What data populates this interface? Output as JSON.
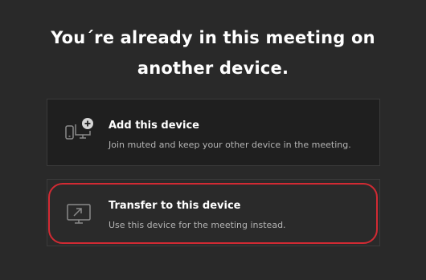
{
  "dialog": {
    "title_line1": "You´re already in this meeting on",
    "title_line2": "another device."
  },
  "options": [
    {
      "icon": "add-device-icon",
      "label": "Add this device",
      "description": "Join muted and keep your other device in the meeting."
    },
    {
      "icon": "transfer-screen-icon",
      "label": "Transfer to this device",
      "description": "Use this device for the meeting instead."
    }
  ],
  "colors": {
    "background": "#292929",
    "card": "#1f1f1f",
    "highlight": "#d22a33",
    "muted_text": "#b4b4b4",
    "icon": "#8a8a8a"
  }
}
